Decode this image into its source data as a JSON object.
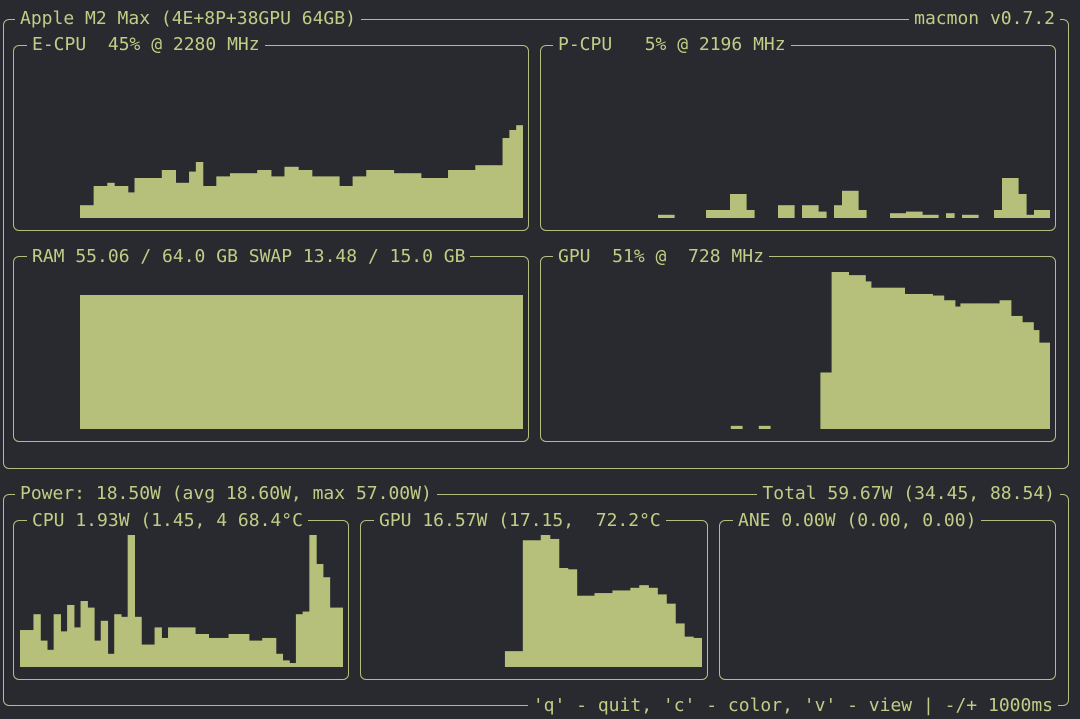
{
  "colors": {
    "background": "#282a2f",
    "text": "#c3cc86",
    "bar": "#b7c07b",
    "border": "#b5bd80"
  },
  "header": {
    "title": "Apple M2 Max (4E+8P+38GPU 64GB)",
    "version": "macmon v0.7.2"
  },
  "panels": {
    "ecpu": {
      "label": "E-CPU  45% @ 2280 MHz",
      "usage_pct": 45,
      "freq_mhz": 2280,
      "history": [
        0.08,
        0.08,
        0.2,
        0.2,
        0.22,
        0.2,
        0.2,
        0.16,
        0.25,
        0.25,
        0.25,
        0.25,
        0.3,
        0.3,
        0.22,
        0.22,
        0.29,
        0.35,
        0.2,
        0.2,
        0.26,
        0.26,
        0.28,
        0.28,
        0.28,
        0.28,
        0.3,
        0.3,
        0.26,
        0.26,
        0.32,
        0.32,
        0.3,
        0.3,
        0.26,
        0.26,
        0.26,
        0.26,
        0.2,
        0.2,
        0.26,
        0.26,
        0.3,
        0.3,
        0.3,
        0.3,
        0.28,
        0.28,
        0.28,
        0.28,
        0.25,
        0.25,
        0.25,
        0.25,
        0.3,
        0.3,
        0.3,
        0.3,
        0.33,
        0.33,
        0.33,
        0.33,
        0.5,
        0.55,
        0.58
      ]
    },
    "pcpu": {
      "label": "P-CPU   5% @ 2196 MHz",
      "usage_pct": 5,
      "freq_mhz": 2196,
      "history": [
        0,
        0,
        0,
        0,
        0,
        0,
        0,
        0,
        0,
        0,
        0,
        0,
        0,
        0,
        0.02,
        0.02,
        0,
        0,
        0,
        0,
        0.05,
        0.05,
        0.05,
        0.15,
        0.15,
        0.05,
        0,
        0,
        0,
        0.08,
        0.08,
        0,
        0.08,
        0.08,
        0.04,
        0,
        0.08,
        0.17,
        0.17,
        0.05,
        0,
        0,
        0,
        0.03,
        0.03,
        0.04,
        0.04,
        0.02,
        0.02,
        0,
        0.03,
        0,
        0.02,
        0.02,
        0,
        0,
        0.05,
        0.25,
        0.25,
        0.15,
        0.02,
        0.05,
        0.05
      ]
    },
    "ram": {
      "label": "RAM 55.06 / 64.0 GB SWAP 13.48 / 15.0 GB",
      "used_gb": 55.06,
      "total_gb": 64.0,
      "swap_used_gb": 13.48,
      "swap_total_gb": 15.0,
      "usage_fraction": 0.86
    },
    "gpu": {
      "label": "GPU  51% @  728 MHz",
      "usage_pct": 51,
      "freq_mhz": 728,
      "history": [
        0,
        0,
        0,
        0,
        0,
        0,
        0,
        0,
        0,
        0,
        0,
        0,
        0,
        0,
        0,
        0,
        0,
        0,
        0,
        0,
        0,
        0,
        0,
        0,
        0,
        0,
        0,
        0,
        0,
        0,
        0,
        0,
        0,
        0.02,
        0.02,
        0,
        0,
        0,
        0.02,
        0.02,
        0,
        0,
        0,
        0,
        0,
        0,
        0,
        0,
        0,
        0.36,
        0.36,
        1.0,
        1.0,
        1.0,
        0.98,
        0.98,
        0.98,
        0.94,
        0.9,
        0.9,
        0.9,
        0.9,
        0.9,
        0.9,
        0.86,
        0.86,
        0.86,
        0.86,
        0.86,
        0.85,
        0.85,
        0.82,
        0.82,
        0.78,
        0.8,
        0.8,
        0.8,
        0.8,
        0.8,
        0.8,
        0.8,
        0.82,
        0.82,
        0.72,
        0.72,
        0.68,
        0.68,
        0.63,
        0.55,
        0.55
      ]
    }
  },
  "power": {
    "label": "Power: 18.50W (avg 18.60W, max 57.00W)",
    "total": "Total 59.67W (34.45, 88.54)",
    "cpu": {
      "label": "CPU 1.93W (1.45, 4 68.4°C",
      "history": [
        0.28,
        0.28,
        0.4,
        0.2,
        0.13,
        0.4,
        0.27,
        0.47,
        0.3,
        0.5,
        0.45,
        0.2,
        0.35,
        0.1,
        0.4,
        0.38,
        1.0,
        0.38,
        0.17,
        0.17,
        0.3,
        0.22,
        0.3,
        0.3,
        0.3,
        0.3,
        0.25,
        0.25,
        0.22,
        0.22,
        0.22,
        0.25,
        0.25,
        0.25,
        0.2,
        0.2,
        0.22,
        0.22,
        0.1,
        0.05,
        0.03,
        0.4,
        0.42,
        1.0,
        0.78,
        0.68,
        0.45,
        0.45
      ]
    },
    "gpu": {
      "label": "GPU 16.57W (17.15,  72.2°C",
      "history": [
        0,
        0,
        0.12,
        0.12,
        0.96,
        0.96,
        1.0,
        0.97,
        0.75,
        0.74,
        0.54,
        0.54,
        0.56,
        0.56,
        0.58,
        0.58,
        0.6,
        0.62,
        0.6,
        0.55,
        0.48,
        0.33,
        0.23,
        0.22
      ]
    },
    "ane": {
      "label": "ANE 0.00W (0.00, 0.00)",
      "history": []
    }
  },
  "footer": {
    "help": "'q' - quit, 'c' - color, 'v' - view | -/+ 1000ms"
  }
}
